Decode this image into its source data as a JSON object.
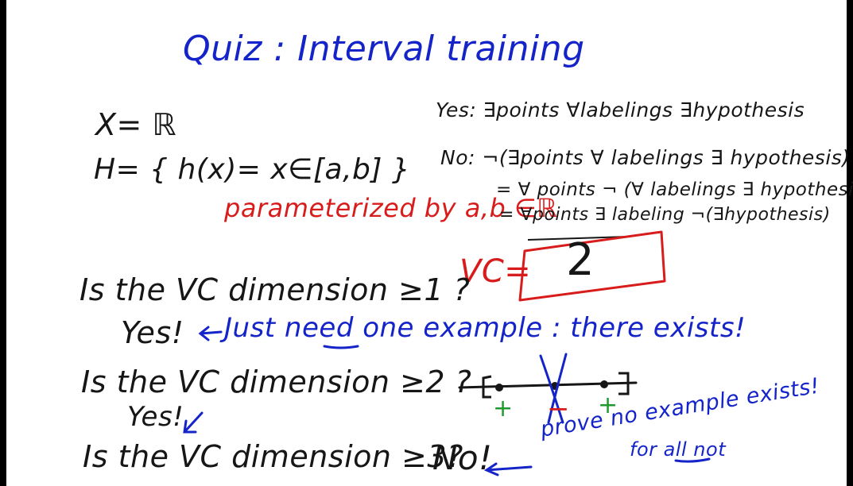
{
  "title": "Quiz : Interval training",
  "x_def": "X= ℝ",
  "h_def": "H= { h(x)= x∈[a,b] }",
  "param_note": "parameterized by a,b ∈ℝ",
  "yes_line": "Yes: ∃points ∀labelings ∃hypothesis",
  "no_line": "No: ¬(∃points ∀ labelings ∃ hypothesis)",
  "equiv_line_1": "= ∀ points ¬ (∀ labelings ∃ hypothesis)",
  "equiv_line_2": "= ∀points ∃ labeling ¬(∃hypothesis)",
  "vc_label": "VC=",
  "vc_answer": "2",
  "q1": "Is the VC dimension ≥1 ?",
  "a1": "Yes!",
  "a1_note": "Just need one example : there exists!",
  "q2": "Is the VC dimension ≥2 ?",
  "a2": "Yes!",
  "labels": [
    "+",
    "−",
    "+"
  ],
  "q3": "Is the VC dimension ≥3?",
  "a3": "No!",
  "a3_note_1": "prove no example exists!",
  "a3_note_2": "for all not",
  "colors": {
    "black_ink": "#161616",
    "blue_ink": "#1424c8",
    "red_ink": "#d81c1c",
    "green_ink": "#1f9a2e",
    "board": "#ffffff"
  }
}
